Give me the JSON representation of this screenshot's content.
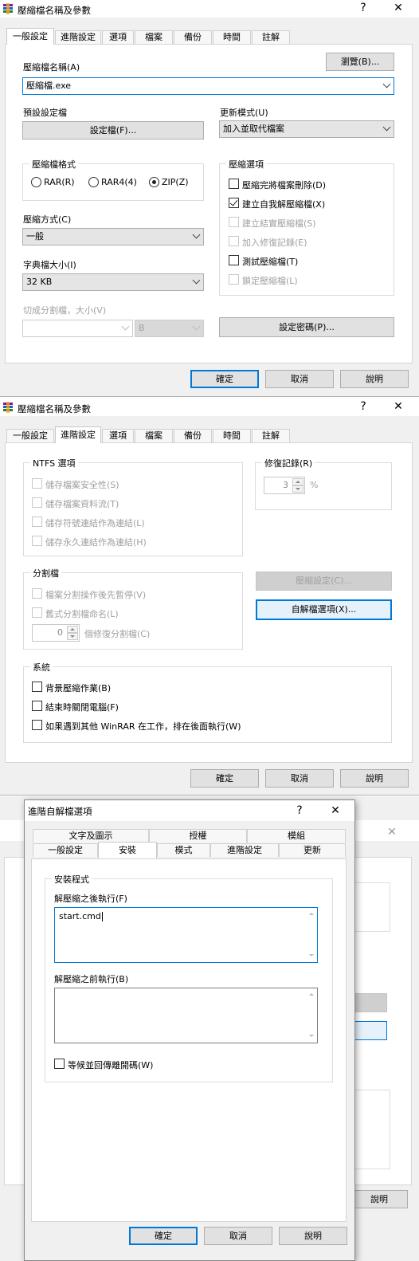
{
  "dialog1": {
    "title": "壓縮檔名稱及參數",
    "help_glyph": "?",
    "close_glyph": "✕",
    "tabs": [
      "一般設定",
      "進階設定",
      "選項",
      "檔案",
      "備份",
      "時間",
      "註解"
    ],
    "archive_name_label": "壓縮檔名稱(A)",
    "archive_name_value": "壓縮檔.exe",
    "browse_button": "瀏覽(B)...",
    "profile_label": "預設設定檔",
    "profile_button": "設定檔(F)...",
    "update_mode_label": "更新模式(U)",
    "update_mode_value": "加入並取代檔案",
    "format_group": "壓縮檔格式",
    "formats": [
      "RAR(R)",
      "RAR4(4)",
      "ZIP(Z)"
    ],
    "selected_format": "ZIP(Z)",
    "method_label": "壓縮方式(C)",
    "method_value": "一般",
    "dict_label": "字典檔大小(I)",
    "dict_value": "32 KB",
    "split_label": "切成分割檔，大小(V)",
    "split_unit": "B",
    "options_group": "壓縮選項",
    "options": [
      {
        "label": "壓縮完將檔案刪除(D)",
        "checked": false,
        "enabled": true
      },
      {
        "label": "建立自我解壓縮檔(X)",
        "checked": true,
        "enabled": true
      },
      {
        "label": "建立結實壓縮檔(S)",
        "checked": false,
        "enabled": false
      },
      {
        "label": "加入修復記錄(E)",
        "checked": false,
        "enabled": false
      },
      {
        "label": "測試壓縮檔(T)",
        "checked": false,
        "enabled": true
      },
      {
        "label": "鎖定壓縮檔(L)",
        "checked": false,
        "enabled": false
      }
    ],
    "password_button": "設定密碼(P)...",
    "ok_button": "確定",
    "cancel_button": "取消",
    "help_button": "說明"
  },
  "dialog2": {
    "title": "壓縮檔名稱及參數",
    "help_glyph": "?",
    "close_glyph": "✕",
    "tabs": [
      "一般設定",
      "進階設定",
      "選項",
      "檔案",
      "備份",
      "時間",
      "註解"
    ],
    "ntfs_group": "NTFS 選項",
    "ntfs_options": [
      "儲存檔案安全性(S)",
      "儲存檔案資料流(T)",
      "儲存符號連結作為連結(L)",
      "儲存永久連結作為連結(H)"
    ],
    "recovery_group": "修復記錄(R)",
    "recovery_value": "3",
    "recovery_unit": "%",
    "split_group": "分割檔",
    "split_options": [
      "檔案分割操作後先暫停(V)",
      "舊式分割檔命名(L)"
    ],
    "split_recovery_value": "0",
    "split_recovery_label": "個修復分割檔(C)",
    "compression_settings_button": "壓縮設定(C)...",
    "sfx_options_button": "自解檔選項(X)...",
    "system_group": "系統",
    "system_options": [
      "背景壓縮作業(B)",
      "結束時關閉電腦(F)",
      "如果遇到其他 WinRAR 在工作，排在後面執行(W)"
    ],
    "ok_button": "確定",
    "cancel_button": "取消",
    "help_button": "說明"
  },
  "dialog3": {
    "title": "進階自解檔選項",
    "help_glyph": "?",
    "close_glyph": "✕",
    "tabs_top": [
      "文字及圖示",
      "授權",
      "模組"
    ],
    "tabs_bottom": [
      "一般設定",
      "安裝",
      "模式",
      "進階設定",
      "更新"
    ],
    "setup_group": "安裝程式",
    "run_after_label": "解壓縮之後執行(F)",
    "run_after_value": "start.cmd",
    "run_before_label": "解壓縮之前執行(B)",
    "run_before_value": "",
    "wait_label": "等候並回傳離開碼(W)",
    "ok_button": "確定",
    "cancel_button": "取消",
    "help_button": "說明"
  },
  "background": {
    "help_button": "說明"
  }
}
